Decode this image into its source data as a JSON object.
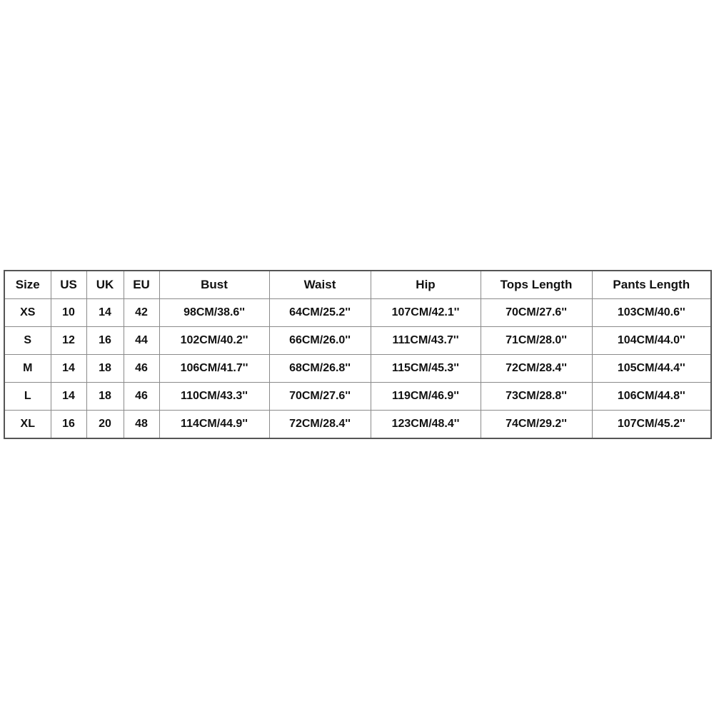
{
  "size_chart": {
    "columns": [
      "Size",
      "US",
      "UK",
      "EU",
      "Bust",
      "Waist",
      "Hip",
      "Tops Length",
      "Pants Length"
    ],
    "rows": [
      [
        "XS",
        "10",
        "14",
        "42",
        "98CM/38.6''",
        "64CM/25.2''",
        "107CM/42.1''",
        "70CM/27.6''",
        "103CM/40.6''"
      ],
      [
        "S",
        "12",
        "16",
        "44",
        "102CM/40.2''",
        "66CM/26.0''",
        "111CM/43.7''",
        "71CM/28.0''",
        "104CM/44.0''"
      ],
      [
        "M",
        "14",
        "18",
        "46",
        "106CM/41.7''",
        "68CM/26.8''",
        "115CM/45.3''",
        "72CM/28.4''",
        "105CM/44.4''"
      ],
      [
        "L",
        "14",
        "18",
        "46",
        "110CM/43.3''",
        "70CM/27.6''",
        "119CM/46.9''",
        "73CM/28.8''",
        "106CM/44.8''"
      ],
      [
        "XL",
        "16",
        "20",
        "48",
        "114CM/44.9''",
        "72CM/28.4''",
        "123CM/48.4''",
        "74CM/29.2''",
        "107CM/45.2''"
      ]
    ]
  }
}
